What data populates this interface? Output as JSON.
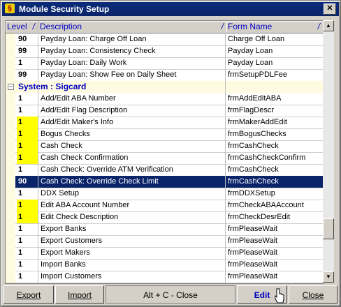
{
  "window": {
    "title": "Module Security Setup",
    "close_glyph": "✕"
  },
  "columns": [
    {
      "label": "Level",
      "sort": "/"
    },
    {
      "label": "Description",
      "sort": "/"
    },
    {
      "label": "Form Name",
      "sort": "/"
    }
  ],
  "rows_top": [
    {
      "level": "90",
      "desc": "Payday Loan: Charge Off Loan",
      "form": "Charge Off Loan",
      "yellow": false
    },
    {
      "level": "99",
      "desc": "Payday Loan: Consistency Check",
      "form": "Payday Loan",
      "yellow": false
    },
    {
      "level": "1",
      "desc": "Payday Loan: Daily Work",
      "form": "Payday Loan",
      "yellow": false
    },
    {
      "level": "99",
      "desc": "Payday Loan: Show Fee on Daily Sheet",
      "form": "frmSetupPDLFee",
      "yellow": false
    }
  ],
  "group": {
    "label": "System : Sigcard",
    "toggle": "−"
  },
  "rows": [
    {
      "level": "1",
      "desc": "Add/Edit ABA Number",
      "form": "frmAddEditABA",
      "yellow": false
    },
    {
      "level": "1",
      "desc": "Add/Edit Flag Description",
      "form": "frmFlagDescr",
      "yellow": false
    },
    {
      "level": "1",
      "desc": "Add/Edit Maker's Info",
      "form": "frmMakerAddEdit",
      "yellow": true
    },
    {
      "level": "1",
      "desc": "Bogus Checks",
      "form": "frmBogusChecks",
      "yellow": true
    },
    {
      "level": "1",
      "desc": "Cash Check",
      "form": "frmCashCheck",
      "yellow": true
    },
    {
      "level": "1",
      "desc": "Cash Check Confirmation",
      "form": "frmCashCheckConfirm",
      "yellow": true
    },
    {
      "level": "1",
      "desc": "Cash Check: Override ATM Verification",
      "form": "frmCashCheck",
      "yellow": false
    },
    {
      "level": "90",
      "desc": "Cash Check: Override Check Limit",
      "form": "frmCashCheck",
      "yellow": false,
      "selected": true
    },
    {
      "level": "1",
      "desc": "DDX Setup",
      "form": "frmDDXSetup",
      "yellow": false
    },
    {
      "level": "1",
      "desc": "Edit ABA Account Number",
      "form": "frmCheckABAAccount",
      "yellow": true
    },
    {
      "level": "1",
      "desc": "Edit Check Description",
      "form": "frmCheckDesrEdit",
      "yellow": true
    },
    {
      "level": "1",
      "desc": "Export Banks",
      "form": "frmPleaseWait",
      "yellow": false
    },
    {
      "level": "1",
      "desc": "Export Customers",
      "form": "frmPleaseWait",
      "yellow": false
    },
    {
      "level": "1",
      "desc": "Export Makers",
      "form": "frmPleaseWait",
      "yellow": false
    },
    {
      "level": "1",
      "desc": "Import Banks",
      "form": "frmPleaseWait",
      "yellow": false
    },
    {
      "level": "1",
      "desc": "Import Customers",
      "form": "frmPleaseWait",
      "yellow": false
    }
  ],
  "buttons": {
    "export": "Export",
    "import": "Import",
    "hint": "Alt + C - Close",
    "edit": "Edit",
    "close": "Close"
  },
  "colors": {
    "selected": "#0a246a",
    "yellow": "#ffff00",
    "header_text": "#0000c0"
  }
}
